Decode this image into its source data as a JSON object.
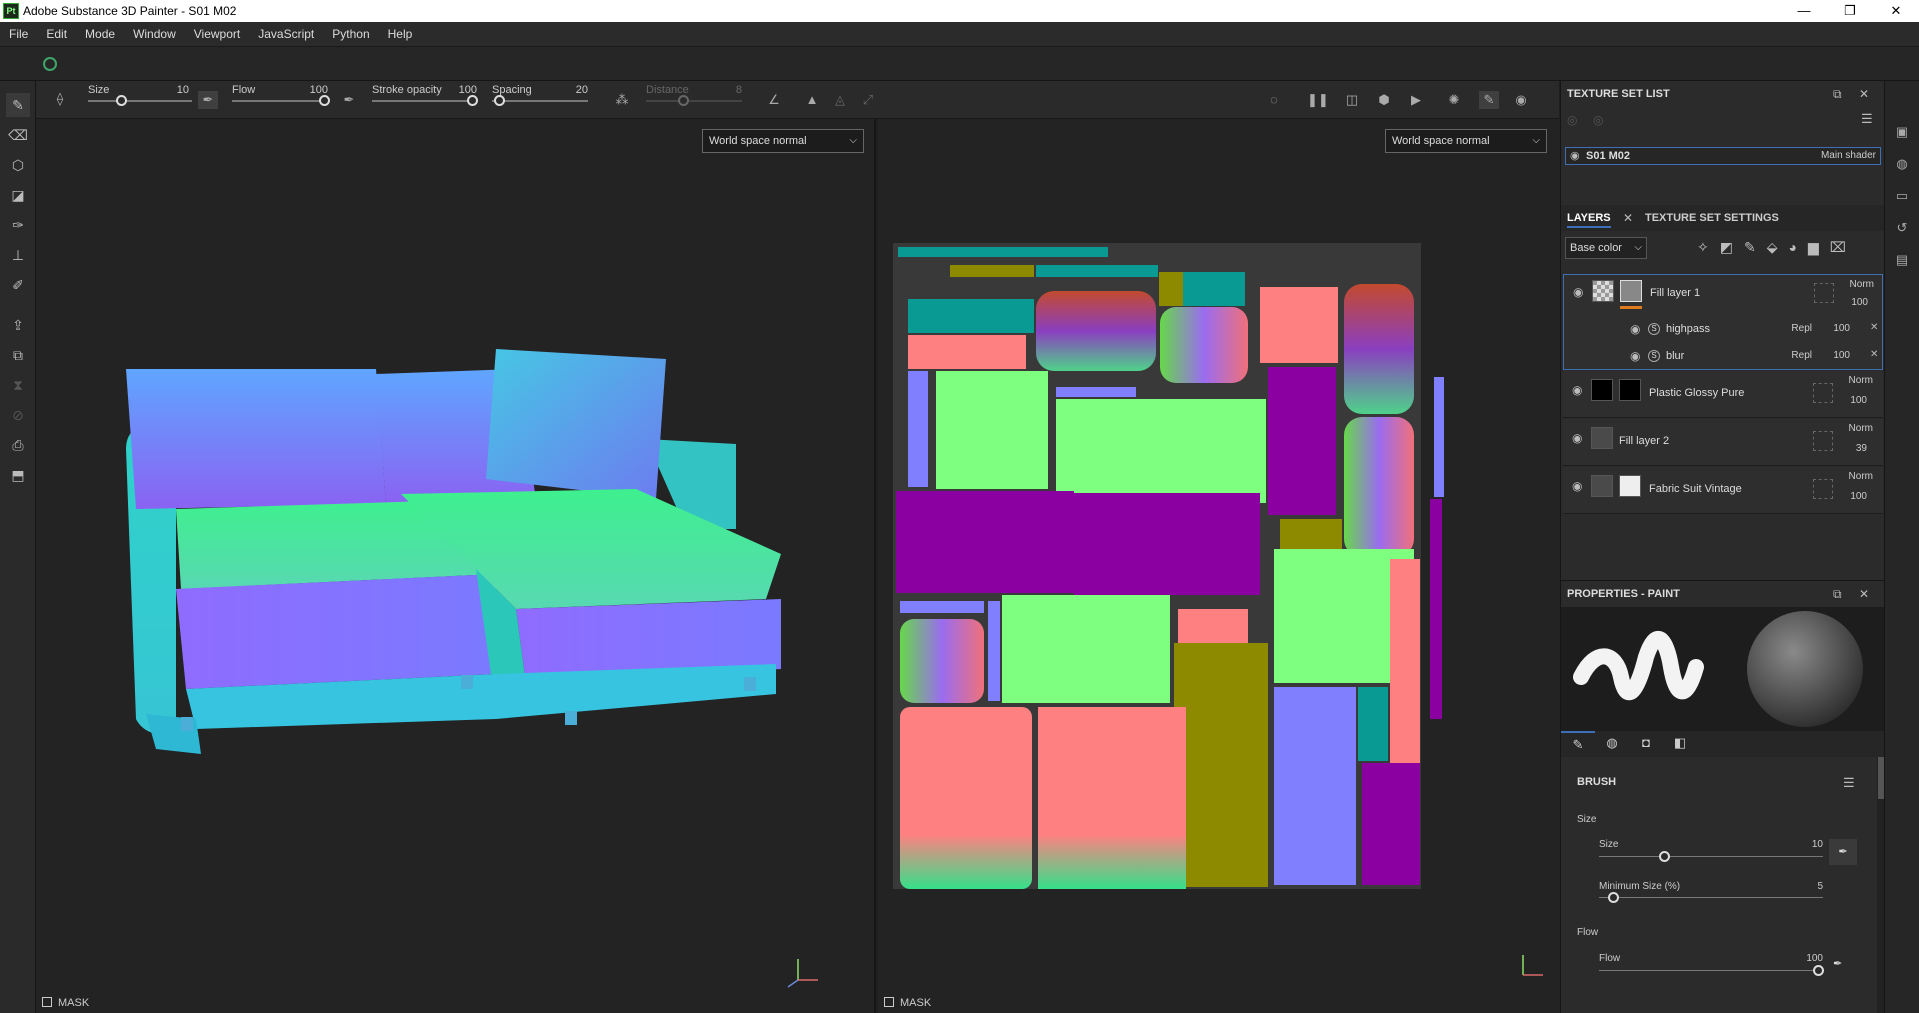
{
  "window": {
    "title": "Adobe Substance 3D Painter - S01 M02",
    "app_badge": "Pt",
    "minimize": "—",
    "maximize": "❐",
    "close": "✕"
  },
  "menu": [
    "File",
    "Edit",
    "Mode",
    "Window",
    "Viewport",
    "JavaScript",
    "Python",
    "Help"
  ],
  "toolbar": {
    "size_label": "Size",
    "size_value": "10",
    "flow_label": "Flow",
    "flow_value": "100",
    "stroke_label": "Stroke opacity",
    "stroke_value": "100",
    "spacing_label": "Spacing",
    "spacing_value": "20",
    "distance_label": "Distance",
    "distance_value": "8"
  },
  "viewport_3d": {
    "mode": "World space normal",
    "mask_label": "MASK"
  },
  "viewport_2d": {
    "mode": "World space normal",
    "mask_label": "MASK"
  },
  "texture_set_list": {
    "title": "TEXTURE SET LIST",
    "item_name": "S01 M02",
    "item_shader": "Main shader"
  },
  "layers_panel": {
    "tab_layers": "LAYERS",
    "tab_settings": "TEXTURE SET SETTINGS",
    "channel": "Base color",
    "layers": [
      {
        "name": "Fill layer 1",
        "blend": "Norm",
        "opacity": "100"
      },
      {
        "name": "highpass",
        "blend": "Repl",
        "opacity": "100"
      },
      {
        "name": "blur",
        "blend": "Repl",
        "opacity": "100"
      },
      {
        "name": "Plastic Glossy Pure",
        "blend": "Norm",
        "opacity": "100"
      },
      {
        "name": "Fill layer 2",
        "blend": "Norm",
        "opacity": "39"
      },
      {
        "name": "Fabric Suit Vintage",
        "blend": "Norm",
        "opacity": "100"
      }
    ]
  },
  "properties": {
    "title": "PROPERTIES - PAINT",
    "section": "BRUSH",
    "size_group": "Size",
    "size_label": "Size",
    "size_value": "10",
    "min_size_label": "Minimum Size (%)",
    "min_size_value": "5",
    "flow_group": "Flow",
    "flow_label": "Flow",
    "flow_value": "100"
  },
  "colors": {
    "accent": "#3d6fb6",
    "orange": "#e07a1f",
    "bg": "#232323"
  }
}
